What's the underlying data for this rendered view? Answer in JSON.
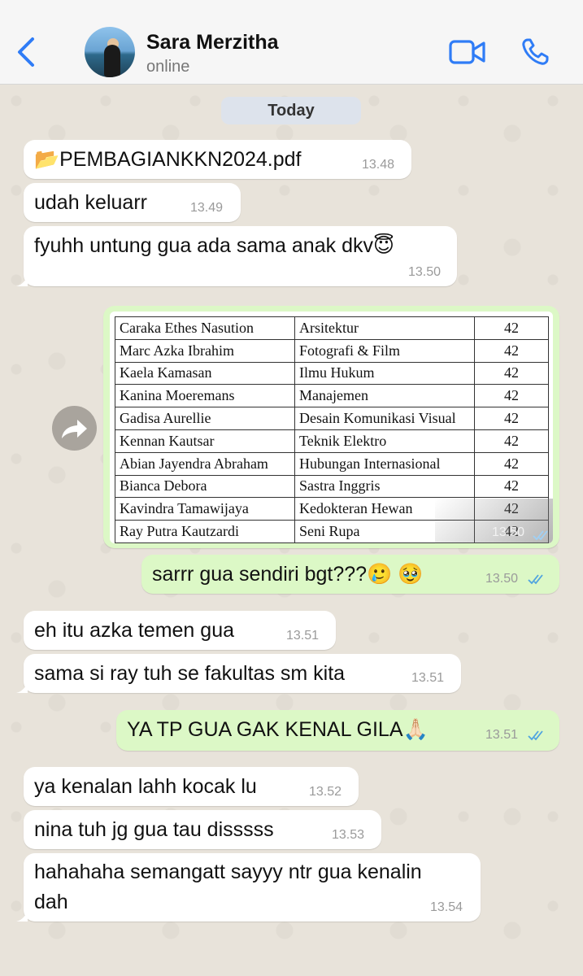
{
  "header": {
    "contact_name": "Sara Merzitha",
    "status": "online"
  },
  "date_divider": "Today",
  "messages": [
    {
      "text": "📂PEMBAGIANKKN2024.pdf",
      "time": "13.48",
      "direction": "in"
    },
    {
      "text": "udah keluarr",
      "time": "13.49",
      "direction": "in"
    },
    {
      "text": "fyuhh untung gua ada sama anak dkv😇",
      "time": "13.50",
      "direction": "in"
    },
    {
      "image_time": "13.50",
      "direction": "out"
    },
    {
      "text": "sarrr gua sendiri bgt???🥲 🥹",
      "time": "13.50",
      "direction": "out"
    },
    {
      "text": "eh itu azka temen gua",
      "time": "13.51",
      "direction": "in"
    },
    {
      "text": "sama si ray tuh se fakultas sm kita",
      "time": "13.51",
      "direction": "in"
    },
    {
      "text": "YA TP GUA GAK KENAL GILA🙏🏻",
      "time": "13.51",
      "direction": "out"
    },
    {
      "text": "ya kenalan lahh kocak lu",
      "time": "13.52",
      "direction": "in"
    },
    {
      "text": "nina tuh jg gua tau disssss",
      "time": "13.53",
      "direction": "in"
    },
    {
      "text_line1": "hahahaha semangatt sayyy ntr gua kenalin",
      "text_line2": "dah",
      "time": "13.54",
      "direction": "in"
    }
  ],
  "image_table": {
    "rows": [
      [
        "Caraka Ethes Nasution",
        "Arsitektur",
        "42"
      ],
      [
        "Marc Azka Ibrahim",
        "Fotografi & Film",
        "42"
      ],
      [
        "Kaela Kamasan",
        "Ilmu Hukum",
        "42"
      ],
      [
        "Kanina Moeremans",
        "Manajemen",
        "42"
      ],
      [
        "Gadisa Aurellie",
        "Desain Komunikasi Visual",
        "42"
      ],
      [
        "Kennan Kautsar",
        "Teknik Elektro",
        "42"
      ],
      [
        "Abian Jayendra Abraham",
        "Hubungan Internasional",
        "42"
      ],
      [
        "Bianca Debora",
        "Sastra Inggris",
        "42"
      ],
      [
        "Kavindra Tamawijaya",
        "Kedokteran Hewan",
        "42"
      ],
      [
        "Ray Putra Kautzardi",
        "Seni Rupa",
        "42"
      ]
    ]
  },
  "colors": {
    "accent_blue": "#2f7cf6",
    "incoming_bubble": "#ffffff",
    "outgoing_bubble": "#dcf8c6",
    "read_ticks": "#4fa3e0"
  },
  "icons": {
    "back": "chevron-left-icon",
    "video": "video-camera-icon",
    "call": "phone-icon",
    "forward": "forward-arrow-icon"
  }
}
